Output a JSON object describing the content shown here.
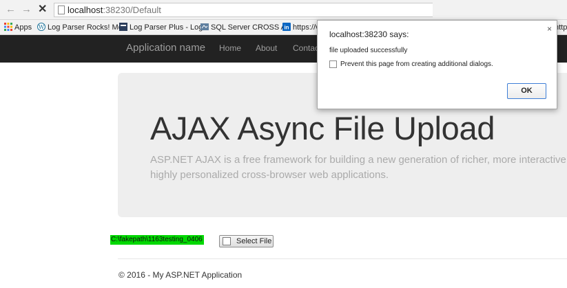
{
  "browser": {
    "url_host": "localhost",
    "url_path": ":38230/Default",
    "bookmarks": [
      {
        "label": "Apps",
        "icon": "apps-grid-icon",
        "color": "#e94235"
      },
      {
        "label": "Log Parser Rocks! Mo",
        "icon": "wordpress-icon",
        "color": "#21759b"
      },
      {
        "label": "Log Parser Plus - Log",
        "icon": "site-icon",
        "color": "#2b3d5b"
      },
      {
        "label": "SQL Server CROSS AP",
        "icon": "sql-site-icon",
        "color": "#5f7f9f"
      },
      {
        "label": "https://v",
        "icon": "linkedin-icon",
        "color": "#0a66c2"
      },
      {
        "label": "http",
        "icon": "page-icon",
        "color": "#999999"
      }
    ]
  },
  "site": {
    "brand": "Application name",
    "nav": [
      "Home",
      "About",
      "Contact"
    ],
    "jumbotron": {
      "title": "AJAX Async File Upload",
      "lead": "ASP.NET AJAX is a free framework for building a new generation of richer, more interactive, highly personalized cross-browser web applications."
    },
    "upload": {
      "file_path": "C:\\fakepath\\1163testing_0406",
      "button_label": "Select File",
      "file_path_highlight": "#00d800"
    },
    "footer": "© 2016 - My ASP.NET Application"
  },
  "dialog": {
    "title": "localhost:38230 says:",
    "close": "×",
    "message": "file uploaded successfully",
    "checkbox_label": "Prevent this page from creating additional dialogs.",
    "ok_label": "OK"
  }
}
